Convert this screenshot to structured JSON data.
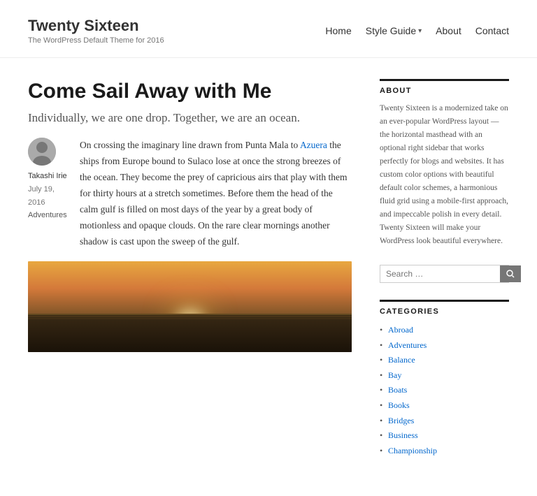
{
  "site": {
    "title": "Twenty Sixteen",
    "description": "The WordPress Default Theme for 2016"
  },
  "nav": {
    "items": [
      {
        "label": "Home",
        "hasDropdown": false
      },
      {
        "label": "Style Guide",
        "hasDropdown": true
      },
      {
        "label": "About",
        "hasDropdown": false
      },
      {
        "label": "Contact",
        "hasDropdown": false
      }
    ]
  },
  "post": {
    "title": "Come Sail Away with Me",
    "subtitle": "Individually, we are one drop. Together, we are an ocean.",
    "author": "Takashi Irie",
    "date": "July 19, 2016",
    "category": "Adventures",
    "body": "On crossing the imaginary line drawn from Punta Mala to Azuera the ships from Europe bound to Sulaco lose at once the strong breezes of the ocean. They become the prey of capricious airs that play with them for thirty hours at a stretch sometimes. Before them the head of the calm gulf is filled on most days of the year by a great body of motionless and opaque clouds. On the rare clear mornings another shadow is cast upon the sweep of the gulf.",
    "link_text": "Azuera"
  },
  "sidebar": {
    "about_title": "ABOUT",
    "about_text": "Twenty Sixteen is a modernized take on an ever-popular WordPress layout — the horizontal masthead with an optional right sidebar that works perfectly for blogs and websites. It has custom color options with beautiful default color schemes, a harmonious fluid grid using a mobile-first approach, and impeccable polish in every detail. Twenty Sixteen will make your WordPress look beautiful everywhere.",
    "search_placeholder": "Search …",
    "search_button_label": "🔍",
    "categories_title": "CATEGORIES",
    "categories": [
      "Abroad",
      "Adventures",
      "Balance",
      "Bay",
      "Boats",
      "Books",
      "Bridges",
      "Business",
      "Championship"
    ]
  }
}
